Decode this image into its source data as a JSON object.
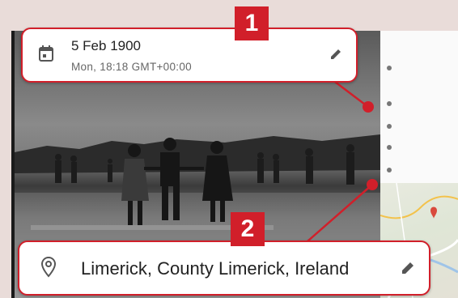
{
  "date_card": {
    "date": "5 Feb 1900",
    "details": "Mon, 18:18   GMT+00:00",
    "icon": "calendar-icon",
    "edit_icon": "pencil-icon"
  },
  "location_card": {
    "place": "Limerick, County Limerick, Ireland",
    "icon": "location-pin-icon",
    "edit_icon": "pencil-icon"
  },
  "badges": {
    "first": "1",
    "second": "2"
  },
  "colors": {
    "accent": "#d11f2a",
    "background": "#e9dcd9"
  }
}
